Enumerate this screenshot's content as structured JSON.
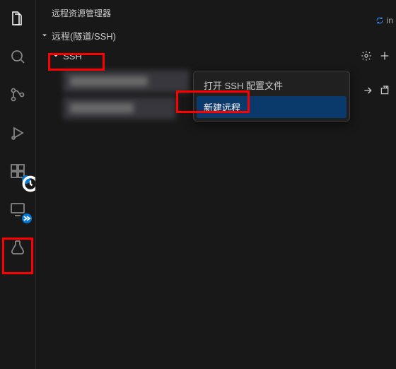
{
  "panel": {
    "title": "远程资源管理器"
  },
  "tree": {
    "root_label": "远程(隧道/SSH)",
    "group_label": "SSH"
  },
  "context_menu": {
    "open_config": "打开 SSH 配置文件",
    "new_remote": "新建远程"
  },
  "status": {
    "right_text": "in"
  },
  "icons": {
    "gear": "gear-icon",
    "plus": "plus-icon",
    "arrow_right": "arrow-right-icon",
    "new_window": "new-window-icon"
  }
}
